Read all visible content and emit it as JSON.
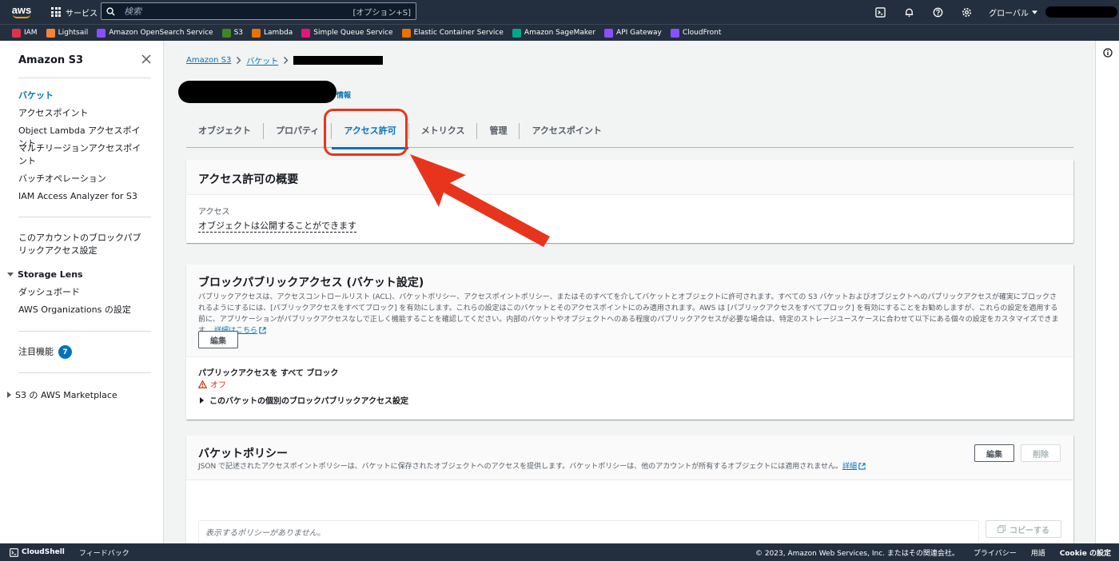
{
  "topnav": {
    "logo": "aws",
    "services": "サービス",
    "search_placeholder": "検索",
    "search_shortcut": "[オプション+S]",
    "region": "グローバル"
  },
  "favorites": [
    {
      "label": "IAM",
      "color": "#dd344c"
    },
    {
      "label": "Lightsail",
      "color": "#f58536"
    },
    {
      "label": "Amazon OpenSearch Service",
      "color": "#8c4fff"
    },
    {
      "label": "S3",
      "color": "#3f8624"
    },
    {
      "label": "Lambda",
      "color": "#ed7100"
    },
    {
      "label": "Simple Queue Service",
      "color": "#e7157b"
    },
    {
      "label": "Elastic Container Service",
      "color": "#ed7100"
    },
    {
      "label": "Amazon SageMaker",
      "color": "#01a88d"
    },
    {
      "label": "API Gateway",
      "color": "#8c4fff"
    },
    {
      "label": "CloudFront",
      "color": "#8c4fff"
    }
  ],
  "sidenav": {
    "title": "Amazon S3",
    "items": [
      "バケット",
      "アクセスポイント",
      "Object Lambda アクセスポイント",
      "マルチリージョンアクセスポイント",
      "バッチオペレーション",
      "IAM Access Analyzer for S3"
    ],
    "block_public": "このアカウントのブロックパブリックアクセス設定",
    "storage_lens": "Storage Lens",
    "storage_lens_items": [
      "ダッシュボード",
      "AWS Organizations の設定"
    ],
    "featured": "注目機能",
    "featured_count": "7",
    "marketplace": "S3 の AWS Marketplace"
  },
  "breadcrumb": {
    "root": "Amazon S3",
    "buckets": "バケット"
  },
  "bucket": {
    "info": "情報"
  },
  "tabs": [
    "オブジェクト",
    "プロパティ",
    "アクセス許可",
    "メトリクス",
    "管理",
    "アクセスポイント"
  ],
  "active_tab": "アクセス許可",
  "overview": {
    "title": "アクセス許可の概要",
    "access_label": "アクセス",
    "access_value": "オブジェクトは公開することができます"
  },
  "bpa": {
    "title": "ブロックパブリックアクセス (バケット設定)",
    "desc": "パブリックアクセスは、アクセスコントロールリスト (ACL)、バケットポリシー、アクセスポイントポリシー、またはそのすべてを介してバケットとオブジェクトに許可されます。すべての S3 バケットおよびオブジェクトへのパブリックアクセスが確実にブロックされるようにするには、[パブリックアクセスをすべてブロック] を有効にします。これらの設定はこのバケットとそのアクセスポイントにのみ適用されます。AWS は [パブリックアクセスをすべてブロック] を有効にすることをお勧めしますが、これらの設定を適用する前に、アプリケーションがパブリックアクセスなしで正しく機能することを確認してください。内部のバケットやオブジェクトへのある程度のパブリックアクセスが必要な場合は、特定のストレージユースケースに合わせて以下にある個々の設定をカスタマイズできます。",
    "learn_more": "詳細はこちら",
    "edit": "編集",
    "block_all_label": "パブリックアクセスを すべて ブロック",
    "status": "オフ",
    "expand": "このバケットの個別のブロックパブリックアクセス設定"
  },
  "policy": {
    "title": "バケットポリシー",
    "desc": "JSON で記述されたアクセスポイントポリシーは、バケットに保存されたオブジェクトへのアクセスを提供します。バケットポリシーは、他のアカウントが所有するオブジェクトには適用されません。",
    "learn_more": "詳細",
    "edit": "編集",
    "delete": "削除",
    "empty": "表示するポリシーがありません。",
    "copy": "コピーする"
  },
  "footer": {
    "cloudshell": "CloudShell",
    "feedback": "フィードバック",
    "copyright": "© 2023, Amazon Web Services, Inc. またはその関連会社。",
    "privacy": "プライバシー",
    "terms": "用語",
    "cookie": "Cookie の設定"
  }
}
